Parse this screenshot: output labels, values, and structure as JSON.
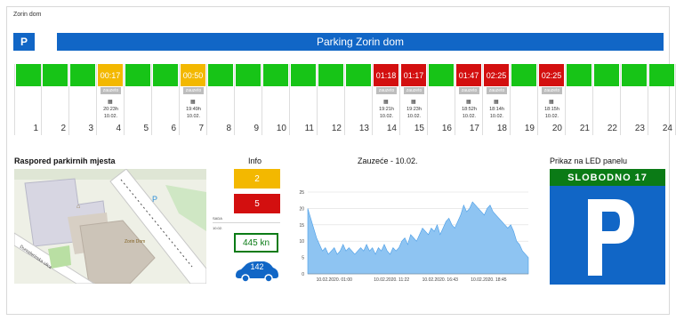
{
  "app": {
    "title": "Zorin dom",
    "logo_letter": "P",
    "banner": "Parking Zorin dom"
  },
  "colors": {
    "free": "#17c417",
    "occupied": "#d30f0f",
    "warning": "#f3b800",
    "brand": "#1166c6"
  },
  "spots": [
    {
      "num": "1",
      "state": "free"
    },
    {
      "num": "2",
      "state": "free"
    },
    {
      "num": "3",
      "state": "free"
    },
    {
      "num": "4",
      "state": "warning",
      "time": "00:17",
      "badge": "zauzeto",
      "since": "20:23h",
      "date": "10.02."
    },
    {
      "num": "5",
      "state": "free"
    },
    {
      "num": "6",
      "state": "free"
    },
    {
      "num": "7",
      "state": "warning",
      "time": "00:50",
      "badge": "zauzeto",
      "since": "19:49h",
      "date": "10.02."
    },
    {
      "num": "8",
      "state": "free"
    },
    {
      "num": "9",
      "state": "free"
    },
    {
      "num": "10",
      "state": "free"
    },
    {
      "num": "11",
      "state": "free"
    },
    {
      "num": "12",
      "state": "free"
    },
    {
      "num": "13",
      "state": "free"
    },
    {
      "num": "14",
      "state": "occupied",
      "time": "01:18",
      "badge": "zauzeto",
      "since": "19:21h",
      "date": "10.02."
    },
    {
      "num": "15",
      "state": "occupied",
      "time": "01:17",
      "badge": "zauzeto",
      "since": "19:23h",
      "date": "10.02."
    },
    {
      "num": "16",
      "state": "free"
    },
    {
      "num": "17",
      "state": "occupied",
      "time": "01:47",
      "badge": "zauzeto",
      "since": "18:52h",
      "date": "10.02."
    },
    {
      "num": "18",
      "state": "occupied",
      "time": "02:25",
      "badge": "zauzeto",
      "since": "18:14h",
      "date": "10.02."
    },
    {
      "num": "19",
      "state": "free"
    },
    {
      "num": "20",
      "state": "occupied",
      "time": "02:25",
      "badge": "zauzeto",
      "since": "18:15h",
      "date": "10.02."
    },
    {
      "num": "21",
      "state": "free"
    },
    {
      "num": "22",
      "state": "free"
    },
    {
      "num": "23",
      "state": "free"
    },
    {
      "num": "24",
      "state": "free"
    }
  ],
  "map": {
    "title": "Raspored parkirnih mjesta",
    "street_label": "Dunoderinska ulica",
    "building_label": "Zorin Dom"
  },
  "info": {
    "title": "Info",
    "warning_count": "2",
    "occupied_count": "5",
    "note_label": "SADA",
    "note_date": "10.02.",
    "revenue": "445 kn",
    "cars": "142"
  },
  "chart_data": {
    "type": "area",
    "title": "Zauzeće - 10.02.",
    "x_ticks": [
      "10.02.2020. 01:00",
      "10.02.2020. 11:22",
      "10.02.2020. 16:43",
      "10.02.2020. 18:45"
    ],
    "y_ticks": [
      "0",
      "5",
      "10",
      "15",
      "20",
      "25"
    ],
    "ylim": [
      0,
      25
    ],
    "values": [
      20,
      17,
      14,
      11,
      9,
      7,
      8,
      6,
      7,
      8,
      6,
      7,
      9,
      7,
      8,
      7,
      6,
      7,
      8,
      7,
      9,
      7,
      8,
      6,
      8,
      7,
      9,
      7,
      6,
      8,
      7,
      8,
      10,
      11,
      9,
      12,
      11,
      10,
      12,
      14,
      13,
      12,
      14,
      13,
      15,
      12,
      14,
      16,
      17,
      15,
      14,
      16,
      18,
      21,
      19,
      20,
      22,
      21,
      20,
      19,
      18,
      20,
      21,
      19,
      18,
      17,
      16,
      15,
      14,
      15,
      13,
      10,
      9,
      7,
      6,
      5
    ]
  },
  "led": {
    "title": "Prikaz na LED panelu",
    "text": "SLOBODNO 17",
    "letter": "P"
  }
}
